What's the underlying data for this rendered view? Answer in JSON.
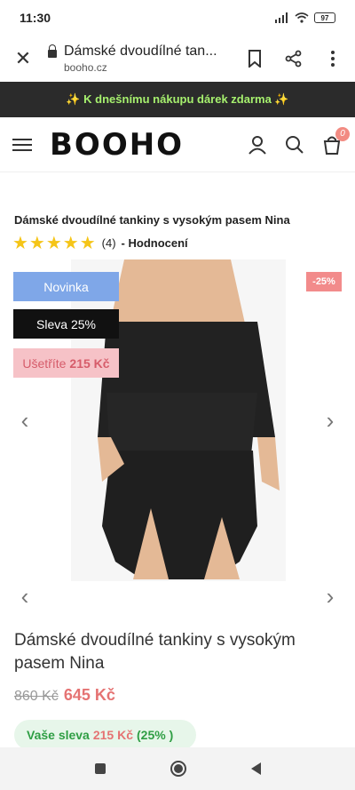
{
  "status": {
    "time": "11:30",
    "battery": "97"
  },
  "browser": {
    "title": "Dámské dvoudílné tan...",
    "domain": "booho.cz"
  },
  "promo": {
    "text": "✨ K dnešnímu nákupu dárek zdarma ✨"
  },
  "header": {
    "logo": "BOOHO",
    "cart_count": "0"
  },
  "product": {
    "short_title": "Dámské dvoudílné tankiny s vysokým pasem Nina",
    "stars": "★★★★★",
    "review_count": "(4)",
    "rating_label": "- Hodnocení",
    "badge_new": "Novinka",
    "badge_sale": "Sleva 25%",
    "badge_save_prefix": "Ušetříte",
    "badge_save_amount": "215 Kč",
    "discount_tag": "-25%",
    "title": "Dámské dvoudílné tankiny s vysokým pasem Nina",
    "old_price": "860 Kč",
    "new_price": "645 Kč",
    "discount_prefix": "Vaše sleva",
    "discount_amount": "215 Kč",
    "discount_percent": "(25% )"
  },
  "colors": {
    "promo_bg": "#2b2b2b",
    "promo_text": "#a6f06e",
    "sale_red": "#e57373",
    "badge_blue": "#7fa7e8",
    "discount_green": "#2f9e44"
  }
}
